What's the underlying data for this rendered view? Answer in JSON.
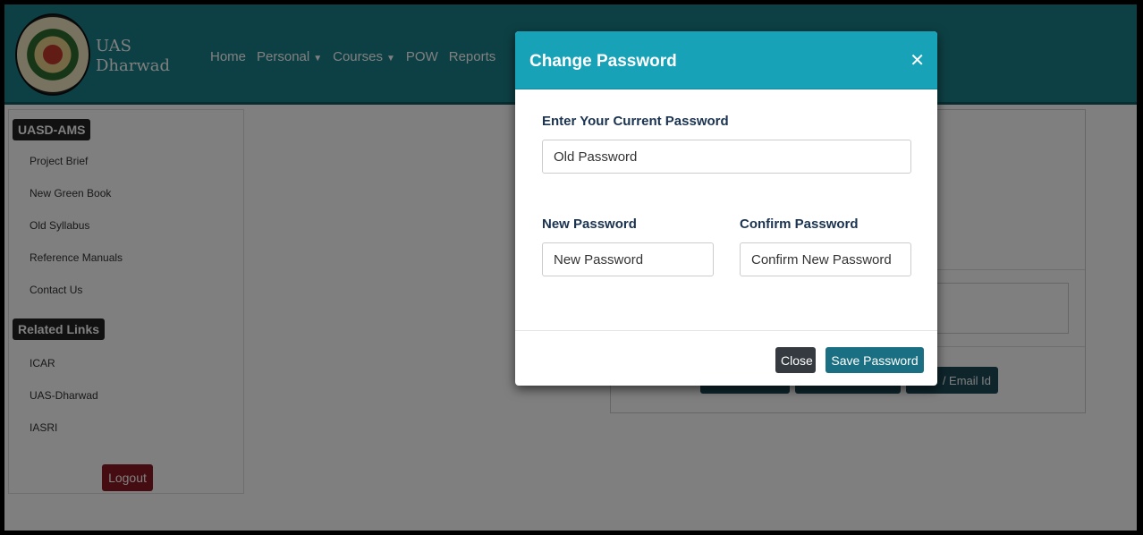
{
  "header": {
    "logo_icon": "university-seal-icon",
    "app_name_line1": "UAS",
    "app_name_line2": "Dharwad",
    "nav": [
      "Home",
      "Personal",
      "Courses",
      "POW",
      "Reports"
    ],
    "accent": "#1a8088"
  },
  "sidebar": {
    "section1_title": "UASD-AMS",
    "section1_items": [
      "Project Brief",
      "New Green Book",
      "Old Syllabus",
      "Reference Manuals",
      "Contact Us"
    ],
    "section2_title": "Related Links",
    "section2_items": [
      "ICAR",
      "UAS-Dharwad",
      "IASRI"
    ],
    "logout_label": "Logout"
  },
  "background": {
    "partial_button_text": "/ Email Id"
  },
  "modal": {
    "title": "Change Password",
    "close_icon": "close-icon",
    "current_label": "Enter Your Current Password",
    "current_placeholder": "Old Password",
    "new_label": "New Password",
    "new_placeholder": "New Password",
    "confirm_label": "Confirm Password",
    "confirm_placeholder": "Confirm New Password",
    "close_button": "Close",
    "save_button": "Save Password",
    "header_color": "#17a2b8"
  }
}
